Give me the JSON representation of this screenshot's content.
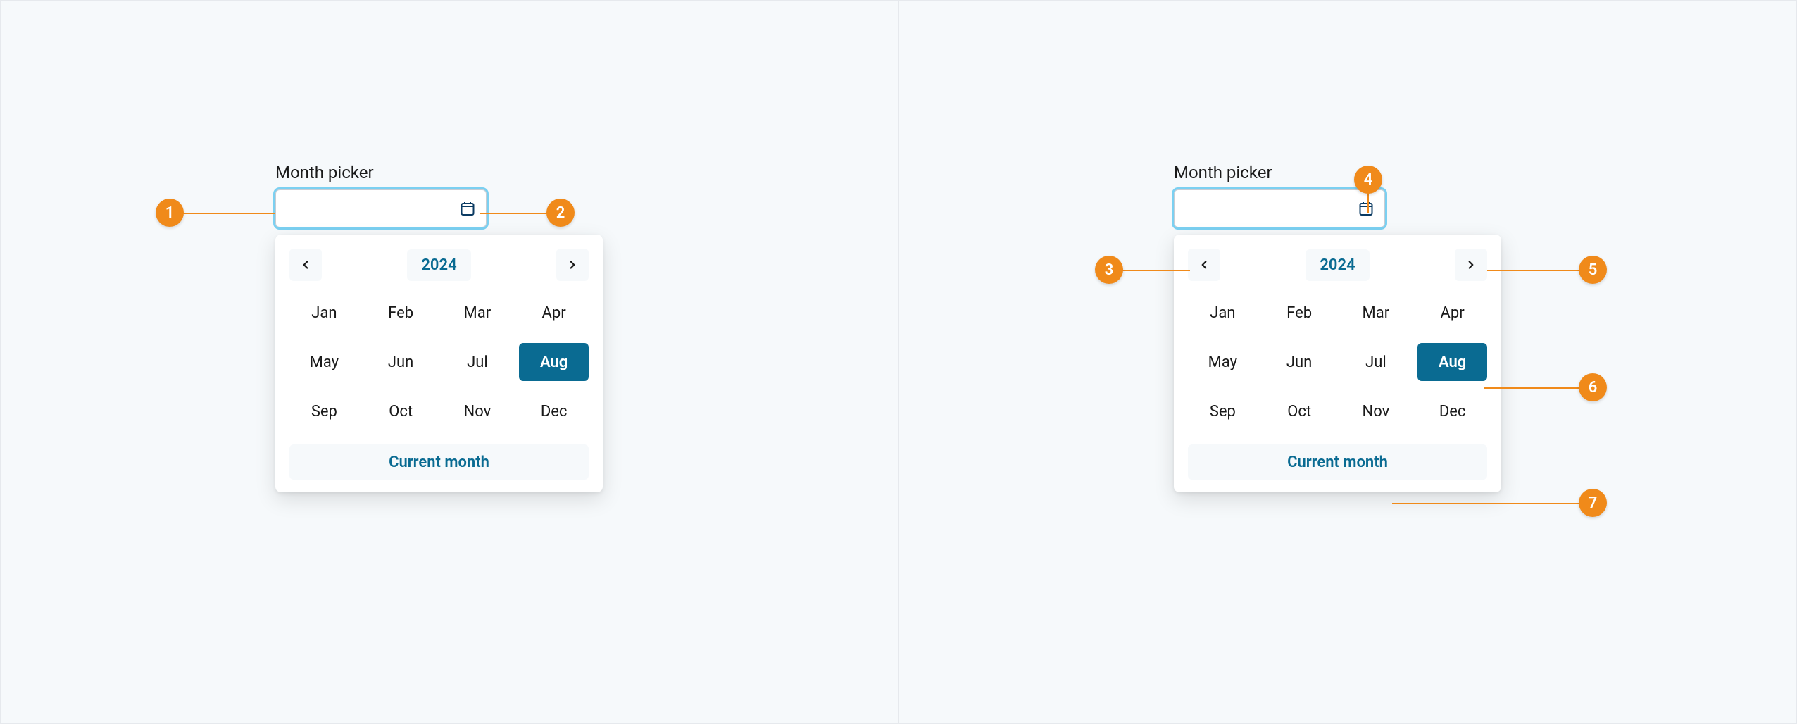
{
  "colors": {
    "accent": "#0a6b92",
    "annotation": "#f08a1a",
    "focus_ring": "#7bd0f1",
    "panel_bg": "#f6f9fb",
    "text": "#1a1a1a"
  },
  "label": "Month picker",
  "year": "2024",
  "footer": "Current month",
  "selected_month": "Aug",
  "months": [
    "Jan",
    "Feb",
    "Mar",
    "Apr",
    "May",
    "Jun",
    "Jul",
    "Aug",
    "Sep",
    "Oct",
    "Nov",
    "Dec"
  ],
  "annotations": {
    "left": [
      {
        "n": "1",
        "target": "input-field"
      },
      {
        "n": "2",
        "target": "calendar-icon"
      }
    ],
    "right": [
      {
        "n": "3",
        "target": "prev-year-button"
      },
      {
        "n": "4",
        "target": "calendar-icon"
      },
      {
        "n": "5",
        "target": "next-year-button"
      },
      {
        "n": "6",
        "target": "selected-month"
      },
      {
        "n": "7",
        "target": "current-month-button"
      }
    ]
  }
}
